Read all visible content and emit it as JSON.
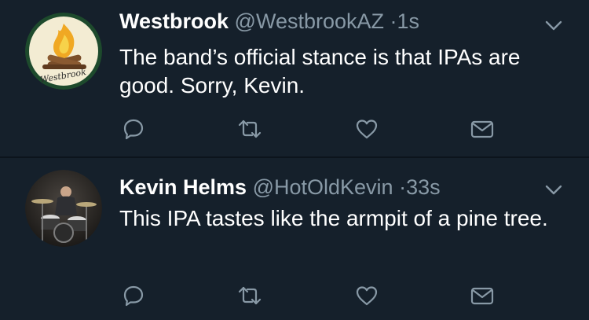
{
  "colors": {
    "background": "#15202b",
    "divider": "#0c141c",
    "name_text": "#ffffff",
    "meta_text": "#8899a6",
    "icon": "#8899a6"
  },
  "tweets": [
    {
      "display_name": "Westbrook",
      "handle": "@WestbrookAZ",
      "separator": "·",
      "time": "1s",
      "text": "The band’s official stance is that IPAs are good. Sorry, Kevin.",
      "avatar": "westbrook-logo",
      "avatar_text": "Westbrook",
      "actions": [
        "reply-icon",
        "retweet-icon",
        "like-icon",
        "direct-message-icon"
      ]
    },
    {
      "display_name": "Kevin Helms",
      "handle": "@HotOldKevin",
      "separator": "·",
      "time": "33s",
      "text": "This IPA tastes like the armpit of a pine tree.",
      "avatar": "drummer-photo",
      "actions": [
        "reply-icon",
        "retweet-icon",
        "like-icon",
        "direct-message-icon"
      ]
    }
  ]
}
